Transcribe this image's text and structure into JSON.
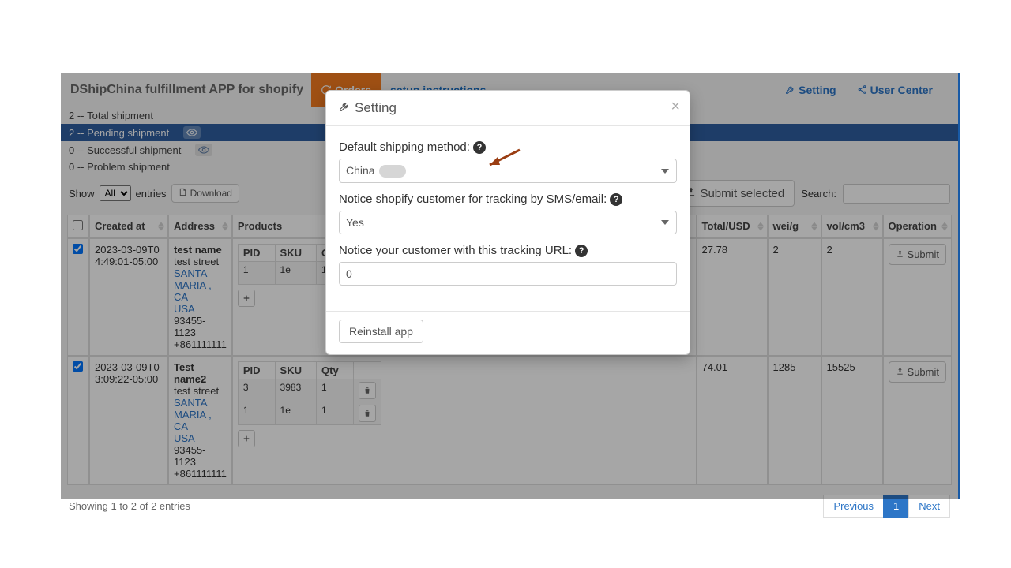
{
  "brand": "DShipChina fulfillment APP for shopify",
  "nav": {
    "orders": "Orders",
    "setup": "setup instructions",
    "setting": "Setting",
    "user_center": "User Center"
  },
  "status": {
    "total": {
      "count": "2",
      "label": "Total shipment"
    },
    "pending": {
      "count": "2",
      "label": "Pending shipment"
    },
    "successful": {
      "count": "0",
      "label": "Successful shipment"
    },
    "problem": {
      "count": "0",
      "label": "Problem shipment"
    }
  },
  "toolbar": {
    "show": "Show",
    "all_option": "All",
    "entries": "entries",
    "download": "Download",
    "submit_selected": "Submit selected",
    "search": "Search:"
  },
  "columns": {
    "created_at": "Created at",
    "address": "Address",
    "products": "Products",
    "total_usd": "Total/USD",
    "wei_g": "wei/g",
    "vol_cm3": "vol/cm3",
    "operation": "Operation"
  },
  "mini_cols": {
    "pid": "PID",
    "sku": "SKU",
    "qty": "Qty"
  },
  "rows": [
    {
      "created": "2023-03-09T04:49:01-05:00",
      "addr_name": "test name",
      "addr_line": "test street",
      "addr_city": "SANTA MARIA , CA",
      "addr_country": "USA",
      "addr_zip": "93455-1123",
      "addr_phone": "+861111111",
      "products": [
        {
          "pid": "1",
          "sku": "1e",
          "qty": "1"
        }
      ],
      "total": "27.78",
      "wei": "2",
      "vol": "2",
      "op": "Submit"
    },
    {
      "created": "2023-03-09T03:09:22-05:00",
      "addr_name": "Test name2",
      "addr_line": "test street",
      "addr_city": "SANTA MARIA , CA",
      "addr_country": "USA",
      "addr_zip": "93455-1123",
      "addr_phone": "+861111111",
      "products": [
        {
          "pid": "3",
          "sku": "3983",
          "qty": "1"
        },
        {
          "pid": "1",
          "sku": "1e",
          "qty": "1"
        }
      ],
      "total": "74.01",
      "wei": "1285",
      "vol": "15525",
      "op": "Submit"
    }
  ],
  "footer": {
    "info": "Showing 1 to 2 of 2 entries",
    "prev": "Previous",
    "page1": "1",
    "next": "Next"
  },
  "modal": {
    "title": "Setting",
    "label_shipping": "Default shipping method:",
    "shipping_value": "China",
    "label_notice_track": "Notice shopify customer for tracking by SMS/email:",
    "notice_value": "Yes",
    "label_tracking_url": "Notice your customer with this tracking URL:",
    "tracking_url_value": "0",
    "reinstall": "Reinstall app"
  }
}
